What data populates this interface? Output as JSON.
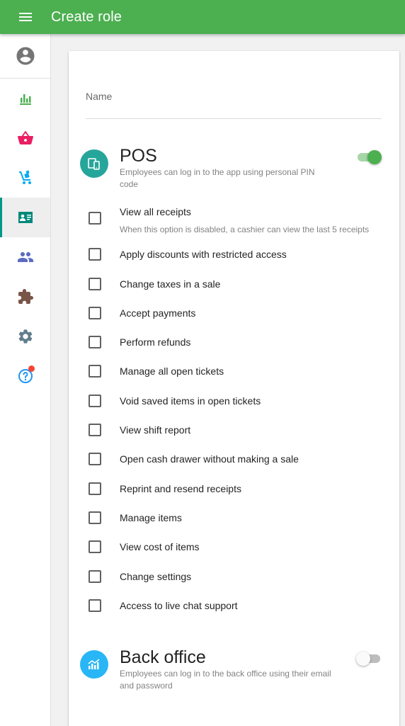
{
  "app_bar": {
    "title": "Create role",
    "menu_icon": "menu-icon"
  },
  "sidebar": {
    "account_icon": "account-circle-icon",
    "items": [
      {
        "name": "reports",
        "icon": "bar-chart-icon",
        "color": "#4caf50"
      },
      {
        "name": "sales",
        "icon": "basket-icon",
        "color": "#e91e63"
      },
      {
        "name": "inventory",
        "icon": "dolly-icon",
        "color": "#03a9f4"
      },
      {
        "name": "employees",
        "icon": "badge-icon",
        "color": "#009688",
        "active": true
      },
      {
        "name": "customers",
        "icon": "people-icon",
        "color": "#5c6bc0"
      },
      {
        "name": "integrations",
        "icon": "puzzle-icon",
        "color": "#795548"
      },
      {
        "name": "settings",
        "icon": "gear-icon",
        "color": "#607d8b"
      },
      {
        "name": "help",
        "icon": "help-icon",
        "color": "#2196f3",
        "notification": true
      }
    ]
  },
  "form": {
    "name_label": "Name",
    "pos": {
      "title": "POS",
      "description": "Employees can log in to the app using personal PIN code",
      "enabled": true,
      "icon_color": "#26a69a",
      "permissions": [
        {
          "label": "View all receipts",
          "sub": "When this option is disabled, a cashier can view the last 5 receipts",
          "checked": false
        },
        {
          "label": "Apply discounts with restricted access",
          "checked": false
        },
        {
          "label": "Change taxes in a sale",
          "checked": false
        },
        {
          "label": "Accept payments",
          "checked": false
        },
        {
          "label": "Perform refunds",
          "checked": false
        },
        {
          "label": "Manage all open tickets",
          "checked": false
        },
        {
          "label": "Void saved items in open tickets",
          "checked": false
        },
        {
          "label": "View shift report",
          "checked": false
        },
        {
          "label": "Open cash drawer without making a sale",
          "checked": false
        },
        {
          "label": "Reprint and resend receipts",
          "checked": false
        },
        {
          "label": "Manage items",
          "checked": false
        },
        {
          "label": "View cost of items",
          "checked": false
        },
        {
          "label": "Change settings",
          "checked": false
        },
        {
          "label": "Access to live chat support",
          "checked": false
        }
      ]
    },
    "back_office": {
      "title": "Back office",
      "description": "Employees can log in to the back office using their email and password",
      "enabled": false,
      "icon_color": "#29b6f6"
    }
  },
  "colors": {
    "primary": "#4caf50",
    "accent": "#009688"
  }
}
